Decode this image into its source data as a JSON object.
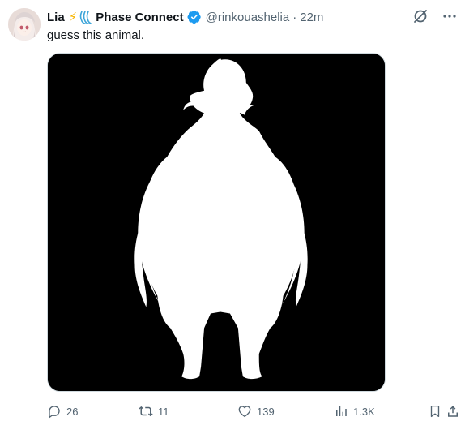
{
  "author": {
    "name": "Lia",
    "bolt_emoji": "⚡",
    "org_name": "Phase Connect",
    "handle": "@rinkouashelia",
    "separator": "·",
    "time": "22m"
  },
  "tweet": {
    "text": "guess this animal."
  },
  "actions": {
    "replies": "26",
    "retweets": "11",
    "likes": "139",
    "views": "1.3K"
  },
  "colors": {
    "verified": "#1d9bf0",
    "secondary_text": "#536471",
    "media_background": "#000000",
    "silhouette": "#ffffff"
  },
  "icons": {
    "grok": "grok-icon",
    "more": "more-icon",
    "reply": "reply-icon",
    "retweet": "retweet-icon",
    "like": "heart-icon",
    "views": "analytics-icon",
    "bookmark": "bookmark-icon",
    "share": "share-icon"
  }
}
